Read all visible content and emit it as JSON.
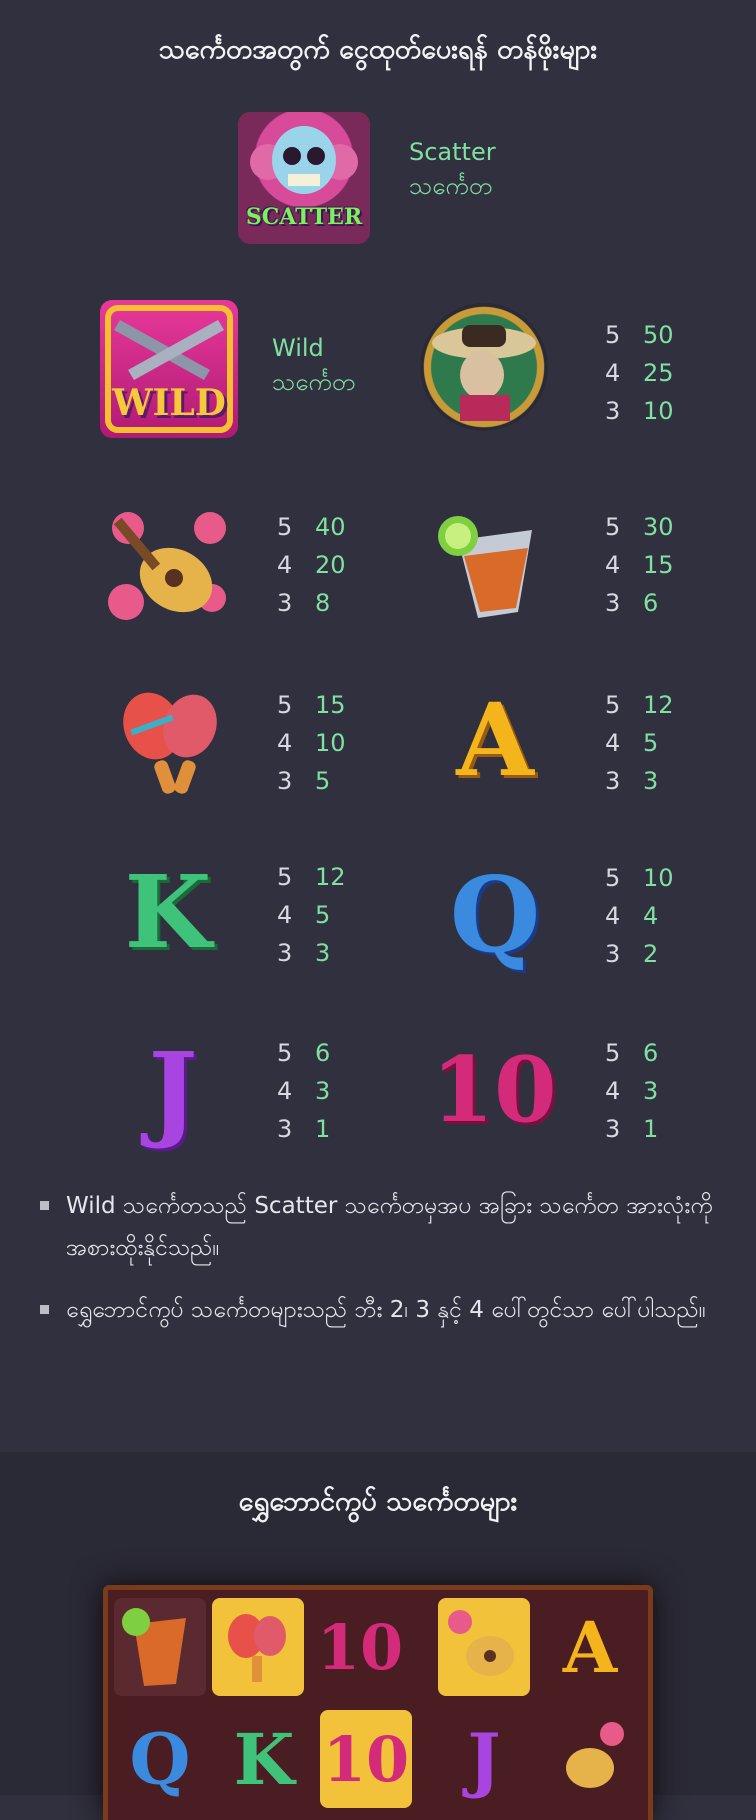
{
  "paytable": {
    "title": "သင်္ကေတအတွက် ငွေထုတ်ပေးရန် တန်ဖိုးများ",
    "scatter": {
      "symbol_text": "SCATTER",
      "name": "Scatter",
      "sub": "သင်္ကေတ",
      "icon": "skull-scatter-icon"
    },
    "wild": {
      "symbol_text": "WILD",
      "name": "Wild",
      "sub": "သင်္ကေတ",
      "icon": "crossed-guns-wild-icon"
    },
    "symbols": [
      {
        "icon": "mariachi-man-icon",
        "pays": [
          {
            "count": "5",
            "amount": "50"
          },
          {
            "count": "4",
            "amount": "25"
          },
          {
            "count": "3",
            "amount": "10"
          }
        ]
      },
      {
        "icon": "guitar-roses-icon",
        "pays": [
          {
            "count": "5",
            "amount": "40"
          },
          {
            "count": "4",
            "amount": "20"
          },
          {
            "count": "3",
            "amount": "8"
          }
        ]
      },
      {
        "icon": "cocktail-lime-icon",
        "pays": [
          {
            "count": "5",
            "amount": "30"
          },
          {
            "count": "4",
            "amount": "15"
          },
          {
            "count": "3",
            "amount": "6"
          }
        ]
      },
      {
        "icon": "maracas-icon",
        "pays": [
          {
            "count": "5",
            "amount": "15"
          },
          {
            "count": "4",
            "amount": "10"
          },
          {
            "count": "3",
            "amount": "5"
          }
        ]
      },
      {
        "icon": "letter-a-icon",
        "letter": "A",
        "pays": [
          {
            "count": "5",
            "amount": "12"
          },
          {
            "count": "4",
            "amount": "5"
          },
          {
            "count": "3",
            "amount": "3"
          }
        ]
      },
      {
        "icon": "letter-k-icon",
        "letter": "K",
        "pays": [
          {
            "count": "5",
            "amount": "12"
          },
          {
            "count": "4",
            "amount": "5"
          },
          {
            "count": "3",
            "amount": "3"
          }
        ]
      },
      {
        "icon": "letter-q-icon",
        "letter": "Q",
        "pays": [
          {
            "count": "5",
            "amount": "10"
          },
          {
            "count": "4",
            "amount": "4"
          },
          {
            "count": "3",
            "amount": "2"
          }
        ]
      },
      {
        "icon": "letter-j-icon",
        "letter": "J",
        "pays": [
          {
            "count": "5",
            "amount": "6"
          },
          {
            "count": "4",
            "amount": "3"
          },
          {
            "count": "3",
            "amount": "1"
          }
        ]
      },
      {
        "icon": "number-10-icon",
        "letter": "10",
        "pays": [
          {
            "count": "5",
            "amount": "6"
          },
          {
            "count": "4",
            "amount": "3"
          },
          {
            "count": "3",
            "amount": "1"
          }
        ]
      }
    ],
    "rules": [
      "Wild သင်္ကေတသည် Scatter သင်္ကေတမှအပ အခြား သင်္ကေတ အားလုံးကို အစားထိုးနိုင်သည်။",
      "ရွှေဘောင်ကွပ် သင်္ကေတများသည် ဘီး 2၊ 3 နှင့် 4 ပေါ်တွင်သာ ပေါ်ပါသည်။"
    ]
  },
  "golden": {
    "title": "ရွှေဘောင်ကွပ် သင်္ကေတများ",
    "reel_row1": [
      "cocktail-lime-icon",
      "maracas-icon",
      "number-10-icon",
      "guitar-roses-icon",
      "letter-a-icon"
    ],
    "reel_row2": [
      "letter-q-icon",
      "letter-k-icon",
      "number-10-icon",
      "letter-j-icon",
      "guitar-roses-icon"
    ],
    "reel_letters": {
      "r1c3": "10",
      "r1c5": "A",
      "r2c1": "Q",
      "r2c2": "K",
      "r2c3": "10",
      "r2c4": "J"
    }
  },
  "colors": {
    "background": "#30303e",
    "accent_green": "#7fe0a0",
    "text": "#e8e8ee"
  }
}
